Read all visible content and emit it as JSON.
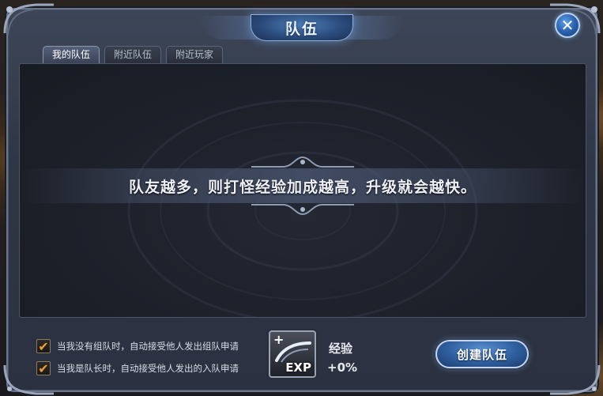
{
  "window": {
    "title": "队伍"
  },
  "tabs": [
    {
      "label": "我的队伍",
      "active": true
    },
    {
      "label": "附近队伍",
      "active": false
    },
    {
      "label": "附近玩家",
      "active": false
    }
  ],
  "content": {
    "message": "队友越多，则打怪经验加成越高，升级就会越快。"
  },
  "options": [
    {
      "label": "当我没有组队时，自动接受他人发出组队申请",
      "checked": true
    },
    {
      "label": "当我是队长时，自动接受他人发出的入队申请",
      "checked": true
    }
  ],
  "exp": {
    "icon_label": "EXP",
    "title": "经验",
    "bonus": "+0%"
  },
  "buttons": {
    "close": "✕",
    "create": "创建队伍"
  },
  "colors": {
    "accent": "#2f5e9e",
    "check": "#f0a030",
    "panel": "#2f3646"
  },
  "icons": [
    "close-icon",
    "checkbox-check-icon",
    "exp-icon"
  ]
}
